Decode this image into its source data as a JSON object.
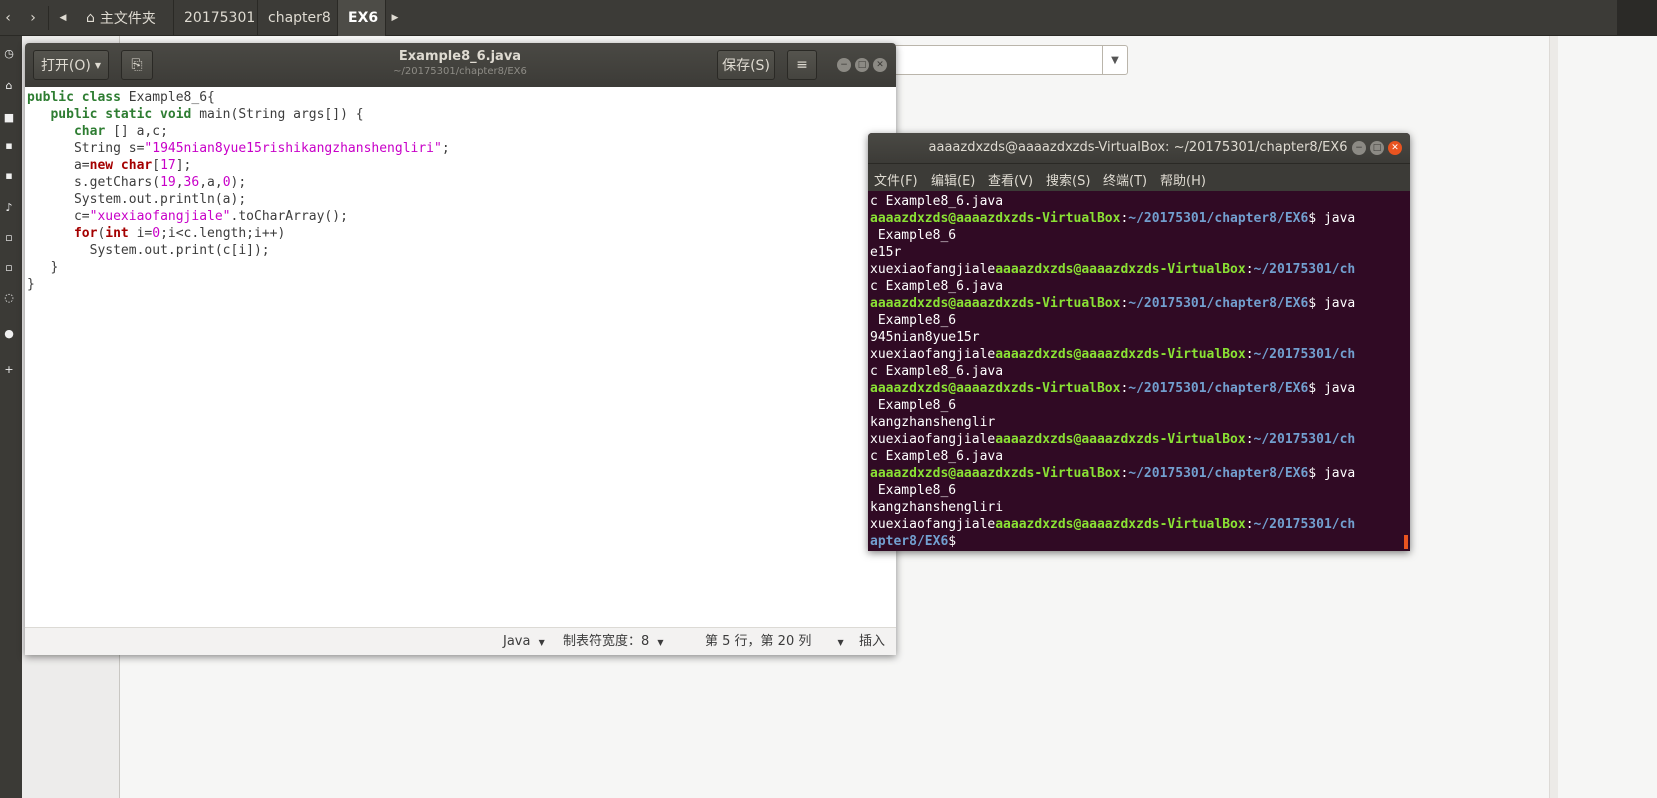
{
  "pathbar": {
    "crumbs": [
      "主文件夹",
      "20175301",
      "chapter8",
      "EX6"
    ]
  },
  "gedit": {
    "open_label": "打开(O)",
    "title": "Example8_6.java",
    "subtitle": "~/20175301/chapter8/EX6",
    "save_label": "保存(S)",
    "code": {
      "l1_kw": "public class",
      "l1_rest": " Example8_6{",
      "l2_kw": "public static void",
      "l2_rest": " main(String args[]) {",
      "l3_kw": "char",
      "l3_rest": " [] a,c;",
      "l4_pre": "String s=",
      "l4_str": "\"1945nian8yue15rishikangzhanshengliri\"",
      "l4_post": ";",
      "l5_pre": "a=",
      "l5_kw": "new char",
      "l5_a": "[",
      "l5_num": "17",
      "l5_b": "];",
      "l6_pre": "s.getChars(",
      "l6_n1": "19",
      "l6_c1": ",",
      "l6_n2": "36",
      "l6_c2": ",a,",
      "l6_n3": "0",
      "l6_post": ");",
      "l7": "System.out.println(a);",
      "l8_pre": "c=",
      "l8_str": "\"xuexiaofangjiale\"",
      "l8_post": ".toCharArray();",
      "l9_kw1": "for",
      "l9_a": "(",
      "l9_kw2": "int",
      "l9_b": " i=",
      "l9_num": "0",
      "l9_post": ";i<c.length;i++)",
      "l10": "System.out.print(c[i]);",
      "l11": "}",
      "l12": "}"
    },
    "status": {
      "language": "Java",
      "tab_width": "制表符宽度：8",
      "position": "第 5 行，第 20 列",
      "mode": "插入"
    }
  },
  "terminal": {
    "title": "aaaazdxzds@aaaazdxzds-VirtualBox: ~/20175301/chapter8/EX6",
    "menu": [
      "文件(F)",
      "编辑(E)",
      "查看(V)",
      "搜索(S)",
      "终端(T)",
      "帮助(H)"
    ],
    "user": "aaaazdxzds@aaaazdxzds-VirtualBox",
    "colon": ":",
    "path": "~/20175301/chapter8/EX6",
    "path_wrap_a": "~/20175301/ch",
    "path_wrap_b": "apter8/EX6",
    "prompt_end": "$ java",
    "prompt_dollar": "$",
    "lines": {
      "compile": "c Example8_6.java",
      "java_arg": " Example8_6",
      "out1": "e15r",
      "out2": "945nian8yue15r",
      "out3": "kangzhanshenglir",
      "out4": "kangzhanshengliri",
      "xuexiao": "xuexiaofangjiale"
    }
  }
}
